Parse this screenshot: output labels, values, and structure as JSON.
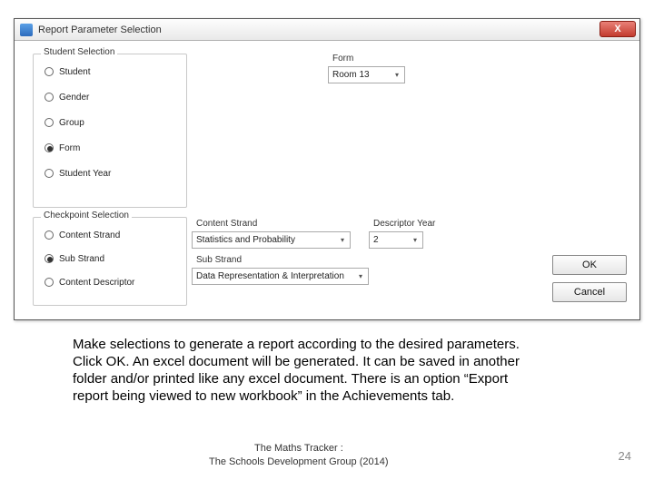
{
  "dialog": {
    "title": "Report Parameter Selection",
    "close_label": "X",
    "ok_label": "OK",
    "cancel_label": "Cancel"
  },
  "student_selection": {
    "legend": "Student Selection",
    "options": {
      "student": "Student",
      "gender": "Gender",
      "group": "Group",
      "form": "Form",
      "student_year": "Student Year"
    }
  },
  "form_field": {
    "label": "Form",
    "value": "Room 13"
  },
  "checkpoint_selection": {
    "legend": "Checkpoint Selection",
    "options": {
      "content_strand": "Content Strand",
      "sub_strand": "Sub Strand",
      "content_descriptor": "Content Descriptor"
    }
  },
  "content_strand_field": {
    "label": "Content Strand",
    "value": "Statistics and Probability"
  },
  "descriptor_year_field": {
    "label": "Descriptor Year",
    "value": "2"
  },
  "sub_strand_field": {
    "label": "Sub Strand",
    "value": "Data Representation & Interpretation"
  },
  "instruction_text": "Make selections to generate a report according to the desired parameters.  Click OK.  An excel document will be generated.  It can be saved in another folder and/or printed like any excel document.  There is an option “Export report being viewed to new workbook” in the Achievements tab.",
  "footer": {
    "line1": "The Maths Tracker :",
    "line2": "The Schools Development Group  (2014)",
    "page_number": "24"
  }
}
